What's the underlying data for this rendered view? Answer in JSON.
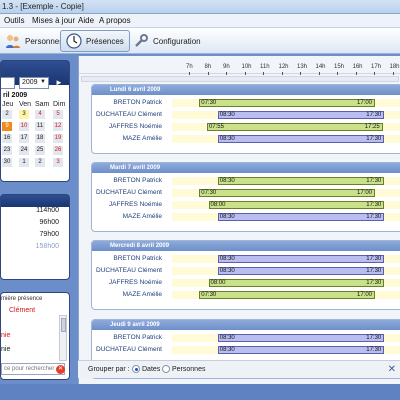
{
  "window": {
    "title": "1.3 - [Exemple - Copie]"
  },
  "menu": [
    "Outils",
    "Mises à jour",
    "Aide",
    "A propos"
  ],
  "toolbar": {
    "personnes": "Personnes",
    "presences": "Présences",
    "configuration": "Configuration"
  },
  "calendar": {
    "year": "2009",
    "month_title": "ril 2009",
    "headers": [
      "Jeu",
      "Ven",
      "Sam",
      "Dim"
    ],
    "rows": [
      [
        "2",
        "3",
        "4",
        "5"
      ],
      [
        "9",
        "10",
        "11",
        "12"
      ],
      [
        "16",
        "17",
        "18",
        "19"
      ],
      [
        "23",
        "24",
        "25",
        "26"
      ],
      [
        "30",
        "1",
        "2",
        "3"
      ]
    ]
  },
  "summary": {
    "values": [
      "114h00",
      "96h00",
      "79h00",
      "158h00"
    ]
  },
  "presence": {
    "header": "mière présence",
    "names": [
      "Clément",
      "nie",
      "nie"
    ],
    "search_placeholder": "ce pour rechercher"
  },
  "hours": [
    "7h",
    "8h",
    "9h",
    "10h",
    "11h",
    "12h",
    "13h",
    "14h",
    "15h",
    "16h",
    "17h",
    "18h",
    "19h"
  ],
  "days": [
    {
      "title": "Lundi 6 avril 2009",
      "rows": [
        {
          "name": "BRETON Patrick",
          "start": "07:30",
          "end": "17:00",
          "color": "green"
        },
        {
          "name": "DUCHATEAU Clément",
          "start": "08:30",
          "end": "17:30",
          "color": "blue"
        },
        {
          "name": "JAFFRES Noémie",
          "start": "07:55",
          "end": "17:25",
          "color": "green"
        },
        {
          "name": "MAZE Amélie",
          "start": "08:30",
          "end": "17:30",
          "color": "blue"
        }
      ]
    },
    {
      "title": "Mardi 7 avril 2009",
      "rows": [
        {
          "name": "BRETON Patrick",
          "start": "08:30",
          "end": "17:30",
          "color": "green"
        },
        {
          "name": "DUCHATEAU Clément",
          "start": "07:30",
          "end": "17:00",
          "color": "green"
        },
        {
          "name": "JAFFRES Noémie",
          "start": "08:00",
          "end": "17:30",
          "color": "green"
        },
        {
          "name": "MAZE Amélie",
          "start": "08:30",
          "end": "17:30",
          "color": "blue"
        }
      ]
    },
    {
      "title": "Mercredi 8 avril 2009",
      "rows": [
        {
          "name": "BRETON Patrick",
          "start": "08:30",
          "end": "17:30",
          "color": "blue"
        },
        {
          "name": "DUCHATEAU Clément",
          "start": "08:30",
          "end": "17:30",
          "color": "blue"
        },
        {
          "name": "JAFFRES Noémie",
          "start": "08:00",
          "end": "17:30",
          "color": "green"
        },
        {
          "name": "MAZE Amélie",
          "start": "07:30",
          "end": "17:00",
          "color": "green"
        }
      ]
    },
    {
      "title": "Jeudi 9 avril 2009",
      "rows": [
        {
          "name": "BRETON Patrick",
          "start": "08:30",
          "end": "17:30",
          "color": "blue"
        },
        {
          "name": "DUCHATEAU Clément",
          "start": "08:30",
          "end": "17:30",
          "color": "blue"
        }
      ]
    }
  ],
  "footer": {
    "group_label": "Grouper par :",
    "opt_dates": "Dates",
    "opt_persons": "Personnes"
  },
  "colors": {
    "green_bar": "#c9e28a",
    "blue_bar": "#b9bdf0",
    "day_header": "#7c9bd2",
    "track": "#fffbd6"
  }
}
